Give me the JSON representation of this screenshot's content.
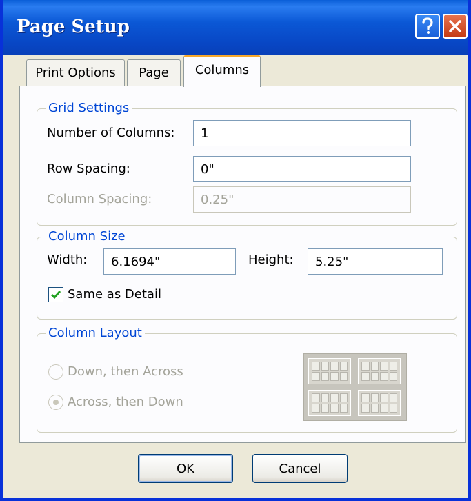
{
  "window": {
    "title": "Page Setup",
    "help_button": "?",
    "close_button": "close"
  },
  "tabs": [
    {
      "label": "Print Options",
      "active": false
    },
    {
      "label": "Page",
      "active": false
    },
    {
      "label": "Columns",
      "active": true
    }
  ],
  "grid_settings": {
    "legend": "Grid Settings",
    "number_of_columns_label": "Number of Columns:",
    "number_of_columns_value": "1",
    "row_spacing_label": "Row Spacing:",
    "row_spacing_value": "0\"",
    "column_spacing_label": "Column Spacing:",
    "column_spacing_value": "0.25\"",
    "column_spacing_enabled": false
  },
  "column_size": {
    "legend": "Column Size",
    "width_label": "Width:",
    "width_value": "6.1694\"",
    "height_label": "Height:",
    "height_value": "5.25\"",
    "same_as_detail_label": "Same as Detail",
    "same_as_detail_checked": true
  },
  "column_layout": {
    "legend": "Column Layout",
    "enabled": false,
    "options": [
      {
        "label": "Down, then Across",
        "selected": false
      },
      {
        "label": "Across, then Down",
        "selected": true
      }
    ]
  },
  "buttons": {
    "ok": "OK",
    "cancel": "Cancel"
  },
  "colors": {
    "title_bar": "#0846c4",
    "group_legend": "#0046d5",
    "active_tab_highlight": "#f7a82b",
    "disabled_text": "#a4a49a"
  }
}
